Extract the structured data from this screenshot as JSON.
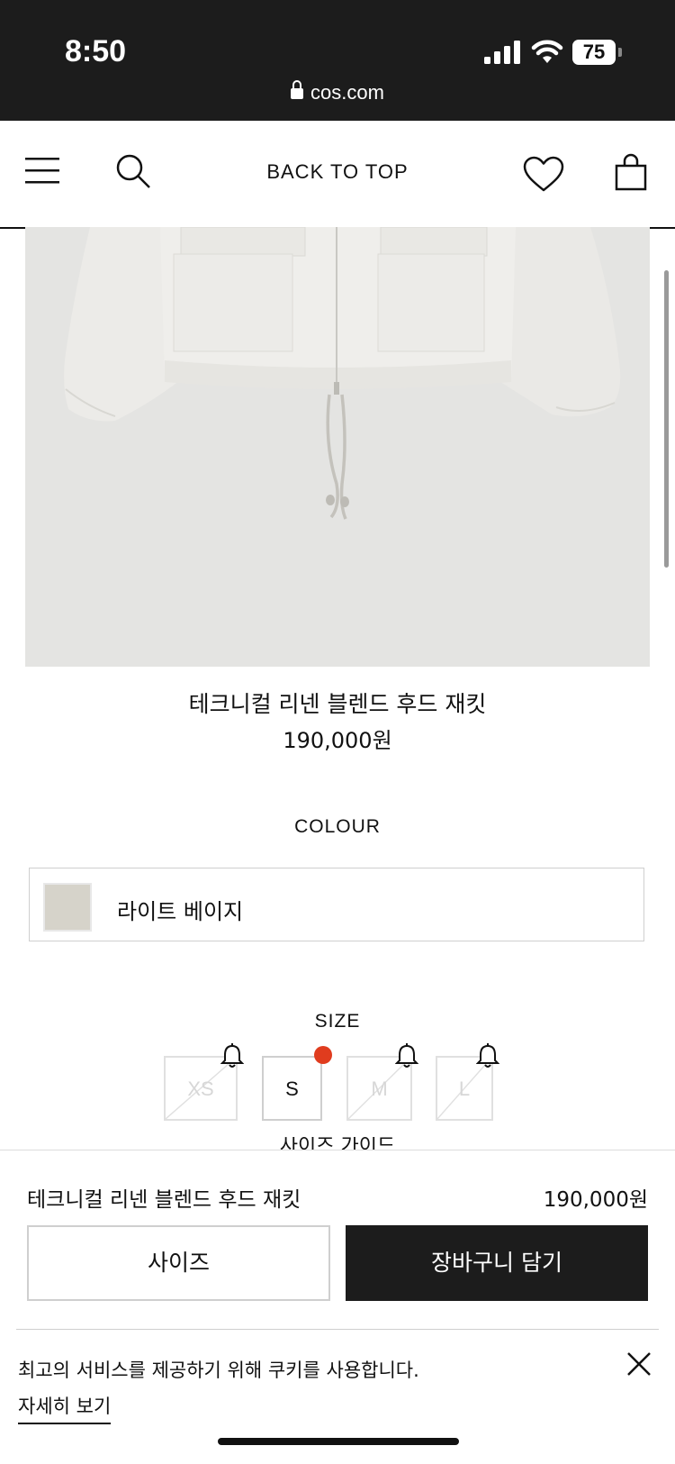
{
  "status_bar": {
    "time": "8:50",
    "battery": "75",
    "url": "cos.com"
  },
  "header": {
    "menu_icon": "hamburger-menu-icon",
    "search_icon": "search-icon",
    "back_to_top": "BACK TO TOP",
    "wishlist_icon": "heart-icon",
    "bag_icon": "shopping-bag-icon"
  },
  "product": {
    "name": "테크니컬 리넨 블렌드 후드 재킷",
    "price": "190,000원",
    "colour_title": "COLOUR",
    "colour_name": "라이트 베이지",
    "colour_hex": "#d6d3ca",
    "size_title": "SIZE",
    "sizes": [
      {
        "label": "XS",
        "available": false,
        "notify_icon": "bell-icon"
      },
      {
        "label": "S",
        "available": true,
        "selected": true
      },
      {
        "label": "M",
        "available": false,
        "notify_icon": "bell-icon"
      },
      {
        "label": "L",
        "available": false,
        "notify_icon": "bell-icon"
      }
    ],
    "size_guide_partial": "사이즈 가이드"
  },
  "sticky_bar": {
    "name": "테크니컬 리넨 블렌드 후드 재킷",
    "price": "190,000원",
    "size_button": "사이즈",
    "cart_button": "장바구니 담기"
  },
  "cookie": {
    "text": "최고의 서비스를 제공하기 위해 쿠키를 사용합니다.",
    "link": "자세히 보기",
    "close_icon": "close-icon"
  },
  "colors": {
    "accent_dot": "#e03c1e",
    "dark": "#1c1c1c"
  }
}
